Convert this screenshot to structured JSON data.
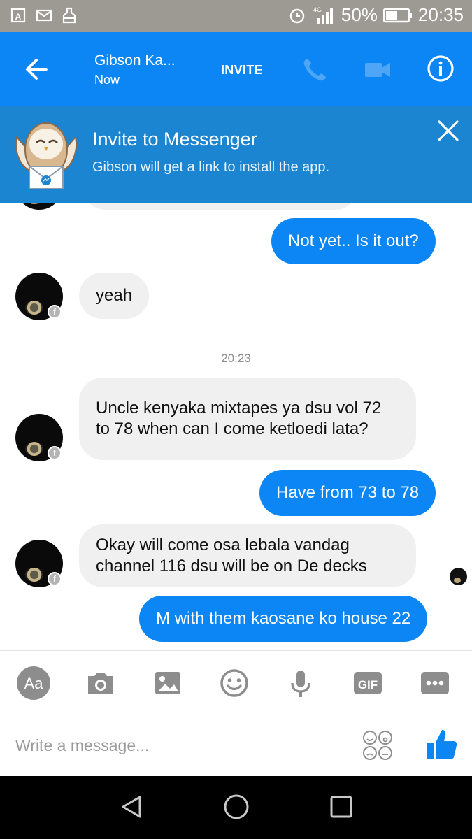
{
  "status_bar": {
    "battery": "50%",
    "time": "20:35",
    "network": "4G"
  },
  "header": {
    "contact_name": "Gibson Ka...",
    "contact_status": "Now",
    "invite_label": "INVITE"
  },
  "banner": {
    "title": "Invite to Messenger",
    "subtitle": "Gibson will get a link to install the app."
  },
  "messages": [
    {
      "from": "me",
      "text": "Not yet.. Is it out?"
    },
    {
      "from": "them",
      "text": "yeah"
    },
    {
      "timestamp": "20:23"
    },
    {
      "from": "them",
      "text": "Uncle kenyaka mixtapes ya dsu vol 72 to 78 when can I come ketloedi lata?"
    },
    {
      "from": "me",
      "text": "Have from 73 to 78"
    },
    {
      "from": "them",
      "text": "Okay will come osa lebala vandag channel 116 dsu will be on De decks"
    },
    {
      "from": "me",
      "text": "M with them kaosane ko house 22"
    }
  ],
  "toolbar": {
    "text_label": "Aa",
    "gif_label": "GIF",
    "icons": [
      "text-format-icon",
      "camera-icon",
      "gallery-icon",
      "emoji-icon",
      "microphone-icon",
      "gif-icon",
      "more-icon"
    ]
  },
  "composer": {
    "placeholder": "Write a message..."
  },
  "colors": {
    "accent": "#0b86f4",
    "banner": "#1b85d2",
    "incoming_bubble": "#f1f0f0",
    "status_bar": "#9c9a92"
  }
}
